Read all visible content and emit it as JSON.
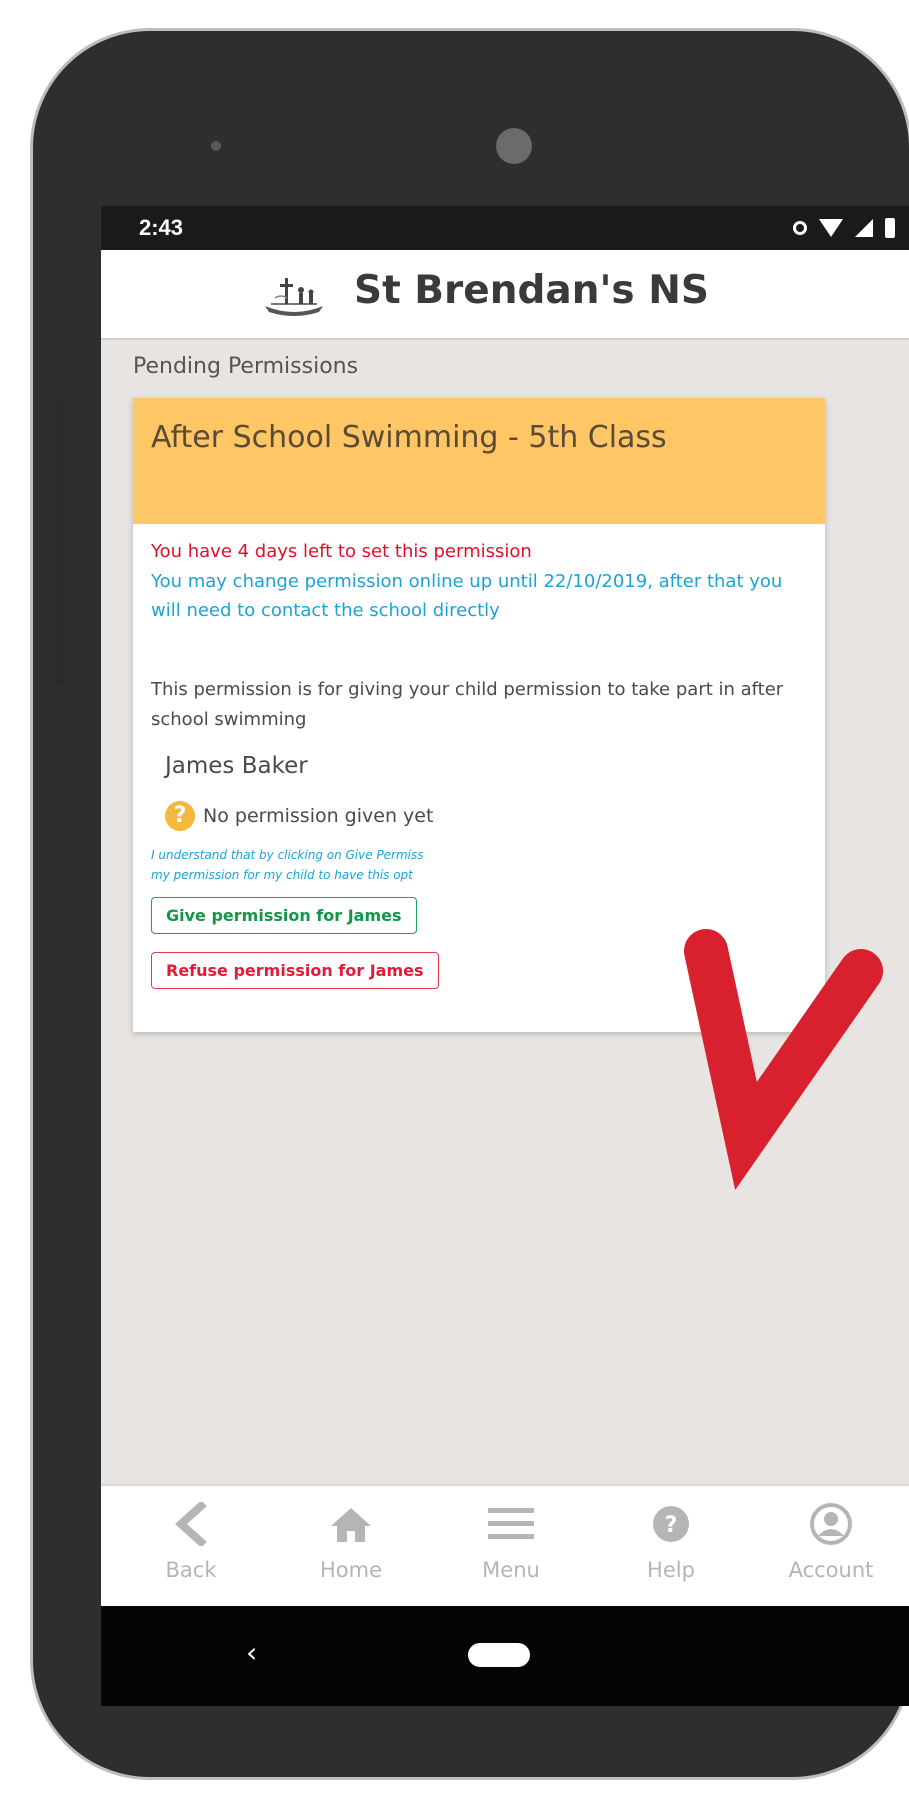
{
  "statusbar": {
    "time": "2:43"
  },
  "app": {
    "title": "St Brendan's NS"
  },
  "section": {
    "heading": "Pending Permissions"
  },
  "permission": {
    "title": "After School Swimming - 5th Class",
    "deadline_text": "You have 4 days left to set this permission",
    "change_notice": "You may change permission online up until 22/10/2019, after that you will need to contact the school directly",
    "description": "This permission is for giving your child permission to take part in after school swimming",
    "child_name": "James Baker",
    "status_text": "No permission given yet",
    "agreement_line1": "I understand that by clicking on Give Permiss",
    "agreement_line2": "my permission for my child to have this opt",
    "give_button": "Give permission for James",
    "refuse_button": "Refuse permission for James"
  },
  "bottom_nav": {
    "items": [
      {
        "label": "Back",
        "icon": "back-chevron-icon"
      },
      {
        "label": "Home",
        "icon": "home-icon"
      },
      {
        "label": "Menu",
        "icon": "menu-icon"
      },
      {
        "label": "Help",
        "icon": "help-icon"
      },
      {
        "label": "Account",
        "icon": "account-icon"
      }
    ]
  },
  "colors": {
    "card_header": "#fec665",
    "deadline": "#e0102a",
    "notice": "#1aa3da",
    "give": "#19a65b",
    "refuse": "#e4384e",
    "arrow": "#d8202e"
  }
}
